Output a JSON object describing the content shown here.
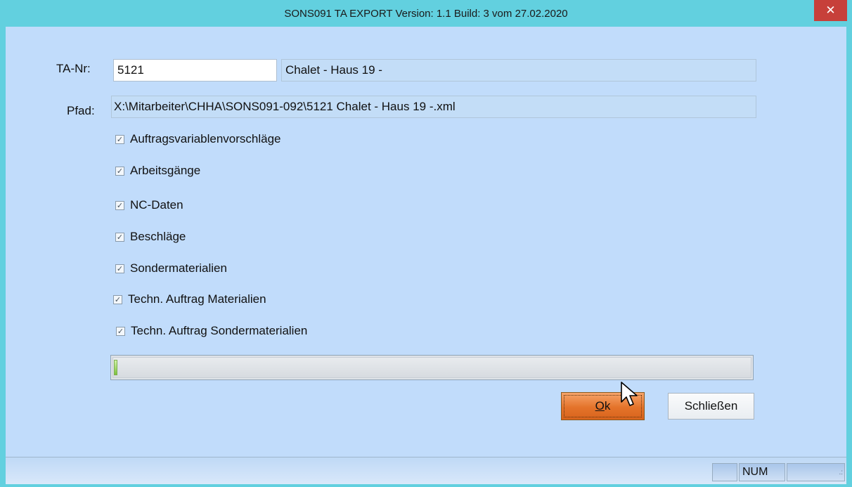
{
  "window": {
    "title": "SONS091 TA EXPORT Version: 1.1 Build: 3 vom 27.02.2020",
    "close_label": "✕"
  },
  "form": {
    "ta_nr_label": "TA-Nr:",
    "ta_nr_value": "5121",
    "ta_description": "Chalet - Haus 19 -",
    "pfad_label": "Pfad:",
    "pfad_value": "X:\\Mitarbeiter\\CHHA\\SONS091-092\\5121 Chalet - Haus 19 -.xml"
  },
  "options": [
    {
      "label": "Auftragsvariablenvorschläge",
      "checked": true
    },
    {
      "label": "Arbeitsgänge",
      "checked": true
    },
    {
      "label": "NC-Daten",
      "checked": true
    },
    {
      "label": "Beschläge",
      "checked": true
    },
    {
      "label": "Sondermaterialien",
      "checked": true
    },
    {
      "label": "Techn. Auftrag Materialien",
      "checked": true
    },
    {
      "label": "Techn. Auftrag Sondermaterialien",
      "checked": true
    }
  ],
  "check_mark": "✓",
  "progress": {
    "fraction": 0.005
  },
  "buttons": {
    "ok_label": "Ok",
    "close_label": "Schließen"
  },
  "statusbar": {
    "num_label": "NUM"
  },
  "colors": {
    "accent_ok": "#e4732a",
    "client_bg": "#c1dcfb",
    "title_bg": "#62d0df",
    "close_bg": "#c7403a"
  }
}
